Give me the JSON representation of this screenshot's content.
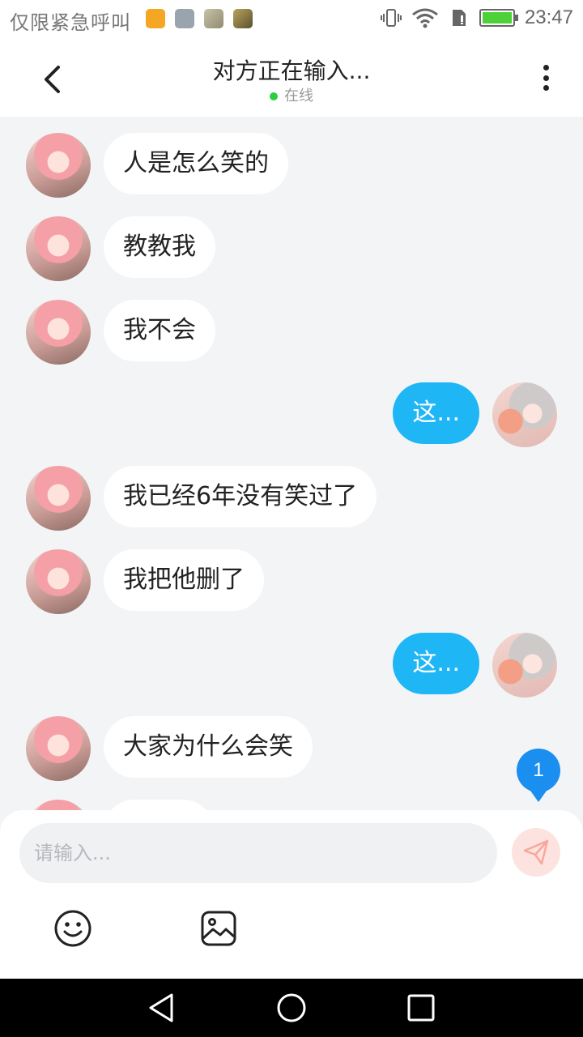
{
  "status_bar": {
    "carrier_text": "仅限紧急呼叫",
    "time": "23:47"
  },
  "header": {
    "title": "对方正在输入...",
    "status": "在线"
  },
  "messages": [
    {
      "side": "left",
      "text": "人是怎么笑的"
    },
    {
      "side": "left",
      "text": "教教我"
    },
    {
      "side": "left",
      "text": "我不会"
    },
    {
      "side": "right",
      "text": "这..."
    },
    {
      "side": "left",
      "text": "我已经6年没有笑过了"
    },
    {
      "side": "left",
      "text": "我把他删了"
    },
    {
      "side": "right",
      "text": "这..."
    },
    {
      "side": "left",
      "text": "大家为什么会笑"
    }
  ],
  "unread_badge": "1",
  "composer": {
    "placeholder": "请输入..."
  },
  "icons": [
    "back-arrow-icon",
    "more-vertical-icon",
    "send-icon",
    "emoji-icon",
    "image-icon",
    "nav-back-icon",
    "nav-home-icon",
    "nav-recents-icon"
  ],
  "colors": {
    "my_bubble": "#1fb6f6",
    "their_bubble": "#ffffff",
    "background": "#f3f4f6",
    "online": "#2ecc40",
    "badge": "#1a8ff0"
  }
}
